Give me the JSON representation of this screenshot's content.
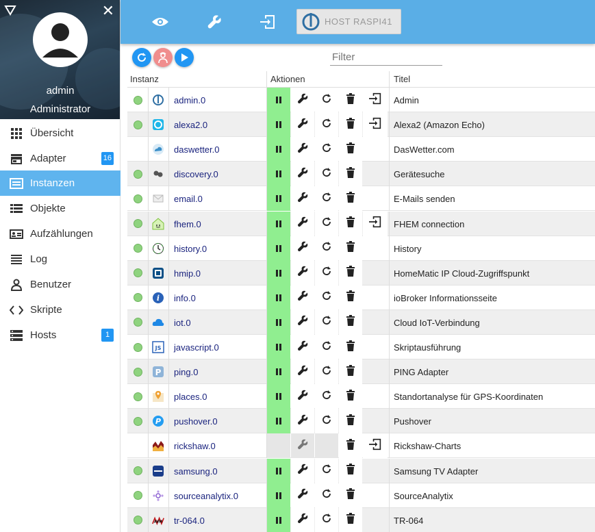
{
  "sidebar": {
    "user_name": "admin",
    "user_role": "Administrator",
    "items": [
      {
        "label": "Übersicht",
        "icon": "grid-icon"
      },
      {
        "label": "Adapter",
        "icon": "store-icon",
        "badge": "16"
      },
      {
        "label": "Instanzen",
        "icon": "instances-icon",
        "active": true
      },
      {
        "label": "Objekte",
        "icon": "list-icon"
      },
      {
        "label": "Aufzählungen",
        "icon": "contact-card-icon"
      },
      {
        "label": "Log",
        "icon": "log-lines-icon"
      },
      {
        "label": "Benutzer",
        "icon": "user-icon"
      },
      {
        "label": "Skripte",
        "icon": "code-icon"
      },
      {
        "label": "Hosts",
        "icon": "hosts-icon",
        "badge": "1"
      }
    ]
  },
  "topbar": {
    "host_label": "HOST RASPI41",
    "accent": "#5aaee6"
  },
  "toolbar": {
    "filter_placeholder": "Filter"
  },
  "table": {
    "headers": {
      "instance": "Instanz",
      "actions": "Aktionen",
      "title": "Titel"
    },
    "rows": [
      {
        "name": "admin.0",
        "title": "Admin",
        "status": "green",
        "running": true,
        "link": true,
        "icon": "admin-icon"
      },
      {
        "name": "alexa2.0",
        "title": "Alexa2 (Amazon Echo)",
        "status": "green",
        "running": true,
        "link": true,
        "icon": "alexa-icon"
      },
      {
        "name": "daswetter.0",
        "title": "DasWetter.com",
        "status": "none",
        "running": true,
        "link": false,
        "icon": "weather-icon"
      },
      {
        "name": "discovery.0",
        "title": "Gerätesuche",
        "status": "green",
        "running": true,
        "link": false,
        "icon": "discovery-icon"
      },
      {
        "name": "email.0",
        "title": "E-Mails senden",
        "status": "green",
        "running": true,
        "link": false,
        "icon": "email-icon"
      },
      {
        "name": "fhem.0",
        "title": "FHEM connection",
        "status": "green",
        "running": true,
        "link": true,
        "icon": "fhem-icon"
      },
      {
        "name": "history.0",
        "title": "History",
        "status": "green",
        "running": true,
        "link": false,
        "icon": "history-icon"
      },
      {
        "name": "hmip.0",
        "title": "HomeMatic IP Cloud-Zugriffspunkt",
        "status": "green",
        "running": true,
        "link": false,
        "icon": "hmip-icon"
      },
      {
        "name": "info.0",
        "title": "ioBroker Informationsseite",
        "status": "green",
        "running": true,
        "link": false,
        "icon": "info-icon"
      },
      {
        "name": "iot.0",
        "title": "Cloud IoT-Verbindung",
        "status": "green",
        "running": true,
        "link": false,
        "icon": "cloud-icon"
      },
      {
        "name": "javascript.0",
        "title": "Skriptausführung",
        "status": "green",
        "running": true,
        "link": false,
        "icon": "javascript-icon"
      },
      {
        "name": "ping.0",
        "title": "PING Adapter",
        "status": "green",
        "running": true,
        "link": false,
        "icon": "ping-icon"
      },
      {
        "name": "places.0",
        "title": "Standortanalyse für GPS-Koordinaten",
        "status": "green",
        "running": true,
        "link": false,
        "icon": "places-icon"
      },
      {
        "name": "pushover.0",
        "title": "Pushover",
        "status": "green",
        "running": true,
        "link": false,
        "icon": "pushover-icon"
      },
      {
        "name": "rickshaw.0",
        "title": "Rickshaw-Charts",
        "status": "none",
        "running": false,
        "link": true,
        "icon": "rickshaw-icon"
      },
      {
        "name": "samsung.0",
        "title": "Samsung TV Adapter",
        "status": "green",
        "running": true,
        "link": false,
        "icon": "samsung-icon"
      },
      {
        "name": "sourceanalytix.0",
        "title": "SourceAnalytix",
        "status": "green",
        "running": true,
        "link": false,
        "icon": "sourceanalytix-icon"
      },
      {
        "name": "tr-064.0",
        "title": "TR-064",
        "status": "green",
        "running": true,
        "link": false,
        "icon": "tr064-icon"
      }
    ]
  }
}
